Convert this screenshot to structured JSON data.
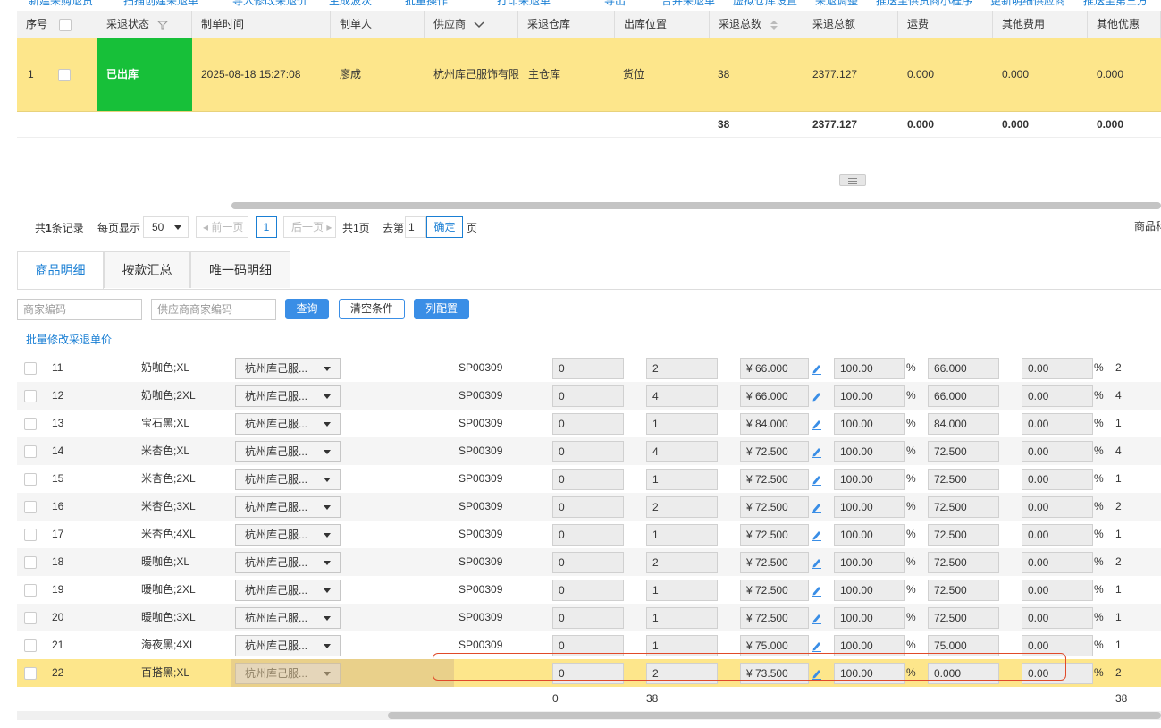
{
  "toolbar": {
    "items": [
      "新建采购退货",
      "扫描创建采退单",
      "导入修改采退价",
      "生成波次",
      "批量操作",
      "打印采退单",
      "导出",
      "合并采退单",
      "虚拟仓库设置",
      "采退调整",
      "推送至供货商小程序",
      "更新明细供应商",
      "推送至第三方"
    ]
  },
  "main_table": {
    "headers": [
      "序号",
      "采退状态",
      "制单时间",
      "制单人",
      "供应商",
      "采退仓库",
      "出库位置",
      "采退总数",
      "采退总额",
      "运费",
      "其他费用",
      "其他优惠"
    ],
    "row": {
      "index": "1",
      "status": "已出库",
      "created_time": "2025-08-18 15:27:08",
      "creator": "廖成",
      "supplier": "杭州库己服饰有限",
      "warehouse": "主仓库",
      "location": "货位",
      "total_qty": "38",
      "total_amount": "2377.127",
      "freight": "0.000",
      "other_fee": "0.000",
      "other_discount": "0.000"
    },
    "summary": {
      "total_qty": "38",
      "total_amount": "2377.127",
      "freight": "0.000",
      "other_fee": "0.000",
      "other_discount": "0.000"
    }
  },
  "pager": {
    "total_prefix": "共",
    "total_count": "1",
    "total_suffix": "条记录",
    "per_page_label": "每页显示",
    "per_page_value": "50",
    "prev_label": "前一页",
    "current_page": "1",
    "next_label": "后一页",
    "total_pages": "共1页",
    "goto_label": "去第",
    "goto_value": "1",
    "confirm_label": "确定",
    "page_suffix": "页",
    "right_label": "商品科"
  },
  "tabs": [
    {
      "label": "商品明细",
      "active": true
    },
    {
      "label": "按款汇总",
      "active": false
    },
    {
      "label": "唯一码明细",
      "active": false
    }
  ],
  "filter": {
    "merchant_code_placeholder": "商家编码",
    "supplier_code_placeholder": "供应商商家编码",
    "query_label": "查询",
    "clear_label": "清空条件",
    "columns_label": "列配置",
    "batch_edit_link": "批量修改采退单价"
  },
  "detail_rows": [
    {
      "idx": "11",
      "spec": "奶咖色;XL",
      "supplier": "杭州库己服...",
      "code": "SP00309",
      "v1": "0",
      "v2": "2",
      "price": "¥ 66.000",
      "rate": "100.00",
      "pct": "%",
      "price2": "66.000",
      "disc": "0.00",
      "qty": "2"
    },
    {
      "idx": "12",
      "spec": "奶咖色;2XL",
      "supplier": "杭州库己服...",
      "code": "SP00309",
      "v1": "0",
      "v2": "4",
      "price": "¥ 66.000",
      "rate": "100.00",
      "pct": "%",
      "price2": "66.000",
      "disc": "0.00",
      "qty": "4"
    },
    {
      "idx": "13",
      "spec": "宝石黑;XL",
      "supplier": "杭州库己服...",
      "code": "SP00309",
      "v1": "0",
      "v2": "1",
      "price": "¥ 84.000",
      "rate": "100.00",
      "pct": "%",
      "price2": "84.000",
      "disc": "0.00",
      "qty": "1"
    },
    {
      "idx": "14",
      "spec": "米杏色;XL",
      "supplier": "杭州库己服...",
      "code": "SP00309",
      "v1": "0",
      "v2": "4",
      "price": "¥ 72.500",
      "rate": "100.00",
      "pct": "%",
      "price2": "72.500",
      "disc": "0.00",
      "qty": "4"
    },
    {
      "idx": "15",
      "spec": "米杏色;2XL",
      "supplier": "杭州库己服...",
      "code": "SP00309",
      "v1": "0",
      "v2": "1",
      "price": "¥ 72.500",
      "rate": "100.00",
      "pct": "%",
      "price2": "72.500",
      "disc": "0.00",
      "qty": "1"
    },
    {
      "idx": "16",
      "spec": "米杏色;3XL",
      "supplier": "杭州库己服...",
      "code": "SP00309",
      "v1": "0",
      "v2": "2",
      "price": "¥ 72.500",
      "rate": "100.00",
      "pct": "%",
      "price2": "72.500",
      "disc": "0.00",
      "qty": "2"
    },
    {
      "idx": "17",
      "spec": "米杏色;4XL",
      "supplier": "杭州库己服...",
      "code": "SP00309",
      "v1": "0",
      "v2": "1",
      "price": "¥ 72.500",
      "rate": "100.00",
      "pct": "%",
      "price2": "72.500",
      "disc": "0.00",
      "qty": "1"
    },
    {
      "idx": "18",
      "spec": "暖咖色;XL",
      "supplier": "杭州库己服...",
      "code": "SP00309",
      "v1": "0",
      "v2": "2",
      "price": "¥ 72.500",
      "rate": "100.00",
      "pct": "%",
      "price2": "72.500",
      "disc": "0.00",
      "qty": "2"
    },
    {
      "idx": "19",
      "spec": "暖咖色;2XL",
      "supplier": "杭州库己服...",
      "code": "SP00309",
      "v1": "0",
      "v2": "1",
      "price": "¥ 72.500",
      "rate": "100.00",
      "pct": "%",
      "price2": "72.500",
      "disc": "0.00",
      "qty": "1"
    },
    {
      "idx": "20",
      "spec": "暖咖色;3XL",
      "supplier": "杭州库己服...",
      "code": "SP00309",
      "v1": "0",
      "v2": "1",
      "price": "¥ 72.500",
      "rate": "100.00",
      "pct": "%",
      "price2": "72.500",
      "disc": "0.00",
      "qty": "1"
    },
    {
      "idx": "21",
      "spec": "海夜黑;4XL",
      "supplier": "杭州库己服...",
      "code": "SP00309",
      "v1": "0",
      "v2": "1",
      "price": "¥ 75.000",
      "rate": "100.00",
      "pct": "%",
      "price2": "75.000",
      "disc": "0.00",
      "qty": "1"
    },
    {
      "idx": "22",
      "spec": "百搭黑;XL",
      "supplier": "杭州库己服...",
      "code": "",
      "v1": "0",
      "v2": "2",
      "price": "¥ 73.500",
      "rate": "100.00",
      "pct": "%",
      "price2": "0.000",
      "disc": "0.00",
      "qty": "2"
    }
  ],
  "detail_summary": {
    "v1": "0",
    "v2": "38",
    "qty": "38"
  },
  "colors": {
    "selected_row": "#fde68b",
    "status_green": "#17c039",
    "accent_blue": "#1a7fd4",
    "highlight_red": "#e04a2a"
  }
}
